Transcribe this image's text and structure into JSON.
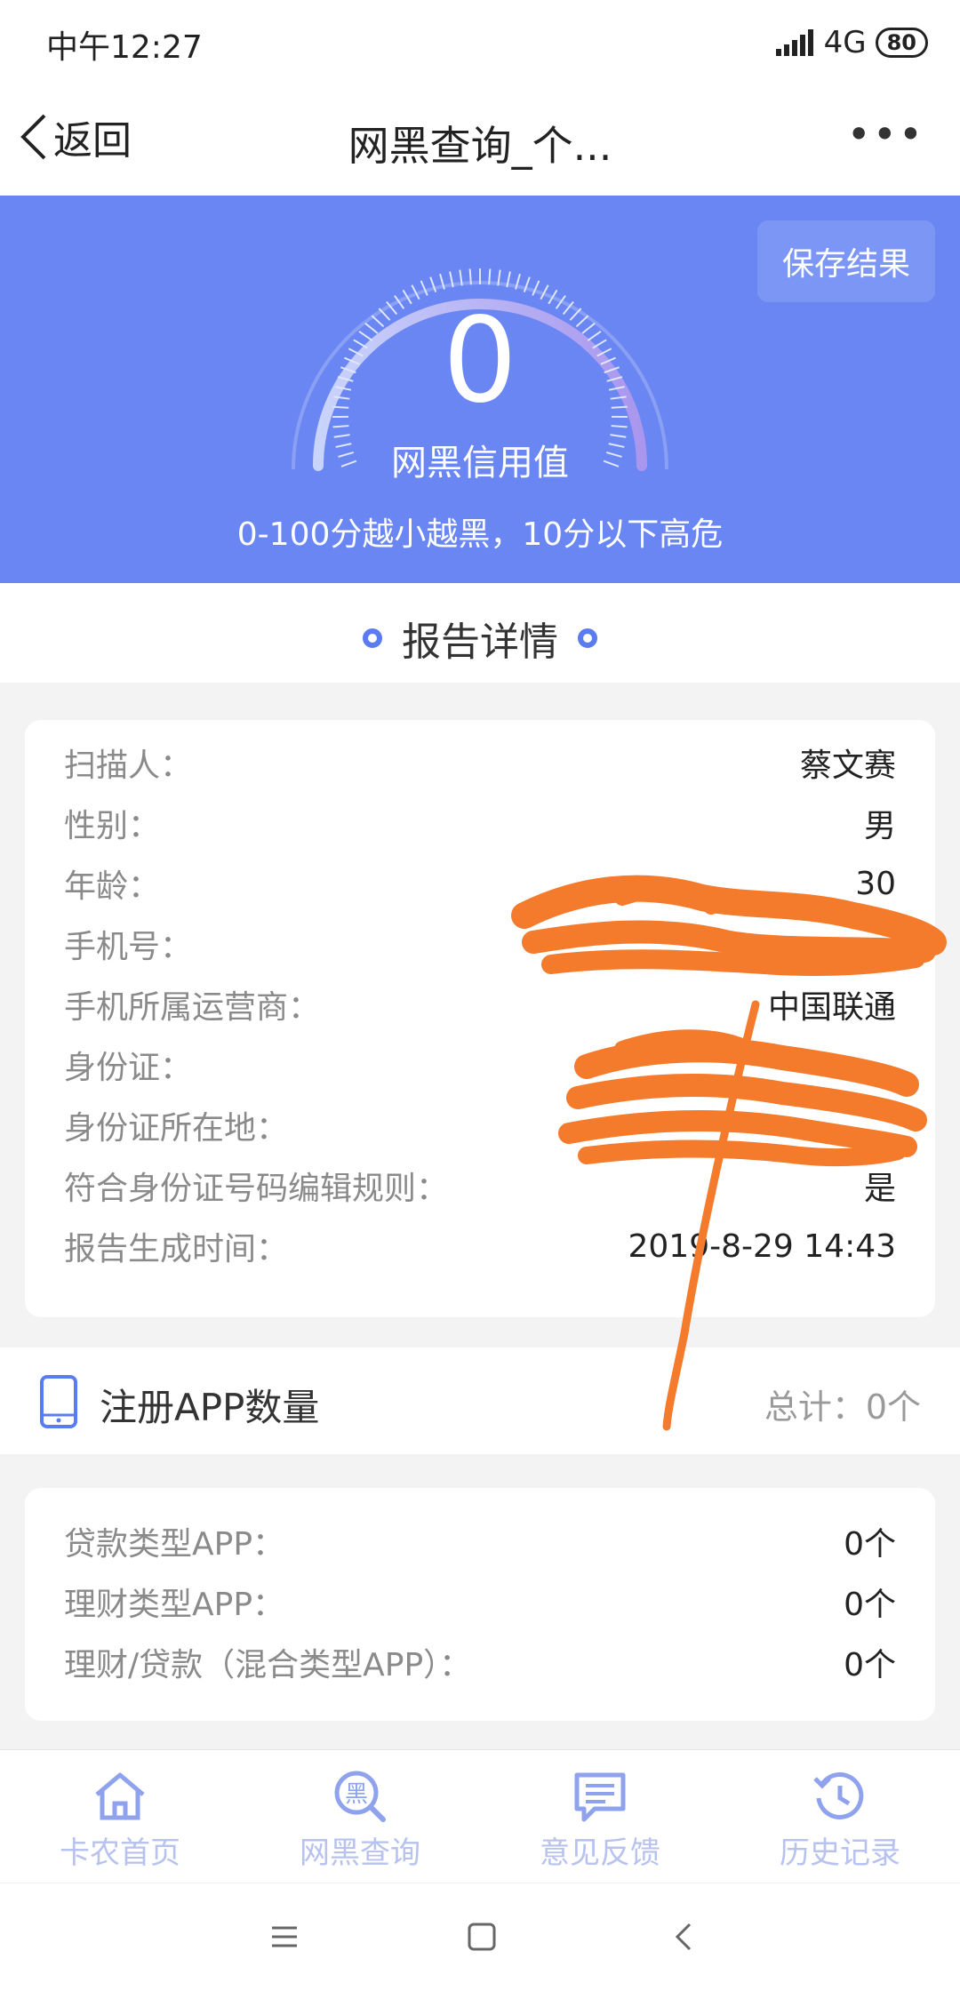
{
  "status_bar": {
    "time": "中午12:27",
    "network": "4G",
    "battery": "80"
  },
  "nav": {
    "back_label": "返回",
    "title": "网黑查询_个...",
    "more": "•••"
  },
  "hero": {
    "save_label": "保存结果",
    "score": "0",
    "score_label": "网黑信用值",
    "description": "0-100分越小越黑，10分以下高危"
  },
  "section_title": "报告详情",
  "details": [
    {
      "key": "扫描人：",
      "value": "蔡文赛"
    },
    {
      "key": "性别：",
      "value": "男"
    },
    {
      "key": "年龄：",
      "value": "30"
    },
    {
      "key": "手机号：",
      "value": ""
    },
    {
      "key": "手机所属运营商：",
      "value": "中国联通"
    },
    {
      "key": "身份证：",
      "value": ""
    },
    {
      "key": "身份证所在地：",
      "value": ""
    },
    {
      "key": "符合身份证号码编辑规则：",
      "value": "是"
    },
    {
      "key": "报告生成时间：",
      "value": "2019-8-29 14:43"
    }
  ],
  "apps": {
    "title": "注册APP数量",
    "total": "总计：0个",
    "rows": [
      {
        "key": "贷款类型APP：",
        "value": "0个"
      },
      {
        "key": "理财类型APP：",
        "value": "0个"
      },
      {
        "key": "理财/贷款（混合类型APP）：",
        "value": "0个"
      }
    ]
  },
  "tabs": [
    {
      "label": "卡农首页",
      "icon": "home-icon"
    },
    {
      "label": "网黑查询",
      "icon": "search-icon"
    },
    {
      "label": "意见反馈",
      "icon": "feedback-icon"
    },
    {
      "label": "历史记录",
      "icon": "history-icon"
    }
  ],
  "colors": {
    "accent": "#6a86f2",
    "tab_inactive": "#b7c2ee",
    "redaction": "#f47a2c"
  }
}
